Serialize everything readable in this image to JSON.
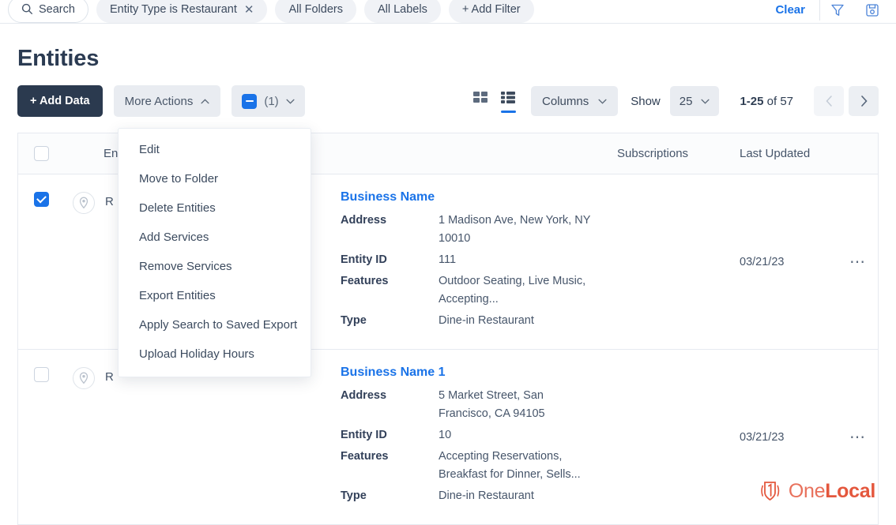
{
  "filter_bar": {
    "search_label": "Search",
    "chips": [
      {
        "label": "Entity Type is Restaurant",
        "removable": true
      },
      {
        "label": "All Folders",
        "removable": false
      },
      {
        "label": "All Labels",
        "removable": false
      },
      {
        "label": "+ Add Filter",
        "removable": false
      }
    ],
    "clear_label": "Clear",
    "icons": [
      "filter-funnel-icon",
      "save-search-icon"
    ]
  },
  "header": {
    "title": "Entities"
  },
  "toolbar": {
    "add_data_label": "+ Add Data",
    "more_actions_label": "More Actions",
    "selection_count_label": "(1)",
    "columns_label": "Columns",
    "show_label": "Show",
    "page_size": "25",
    "range_bold": "1-25",
    "range_rest": " of 57",
    "view_grid_icon": "grid-view-icon",
    "view_list_icon": "list-view-icon",
    "active_view": "list"
  },
  "more_actions_menu": {
    "open": true,
    "items": [
      "Edit",
      "Move to Folder",
      "Delete Entities",
      "Add Services",
      "Remove Services",
      "Export Entities",
      "Apply Search to Saved Export",
      "Upload Holiday Hours"
    ]
  },
  "table": {
    "columns": {
      "entity": "Entity",
      "subscriptions": "Subscriptions",
      "last_updated": "Last Updated"
    },
    "rows": [
      {
        "selected": true,
        "entity_name": "R",
        "business_name": "Business Name",
        "fields": [
          {
            "key": "Address",
            "value": "1 Madison Ave, New York, NY 10010"
          },
          {
            "key": "Entity ID",
            "value": "111"
          },
          {
            "key": "Features",
            "value": "Outdoor Seating, Live Music, Accepting..."
          },
          {
            "key": "Type",
            "value": "Dine-in Restaurant"
          }
        ],
        "subscriptions": "",
        "last_updated": "03/21/23"
      },
      {
        "selected": false,
        "entity_name": "R",
        "business_name": "Business Name 1",
        "fields": [
          {
            "key": "Address",
            "value": "5 Market Street, San Francisco, CA 94105"
          },
          {
            "key": "Entity ID",
            "value": "10"
          },
          {
            "key": "Features",
            "value": "Accepting Reservations, Breakfast for Dinner, Sells..."
          },
          {
            "key": "Type",
            "value": "Dine-in Restaurant"
          }
        ],
        "subscriptions": "",
        "last_updated": "03/21/23"
      }
    ]
  },
  "branding": {
    "name_light": "One",
    "name_bold": "Local"
  },
  "colors": {
    "accent_blue": "#1a73e8",
    "dark_button": "#2b3a4f",
    "chip_grey": "#e9ecf1",
    "brand_orange": "#e4573d",
    "text": "#2f3e53"
  }
}
